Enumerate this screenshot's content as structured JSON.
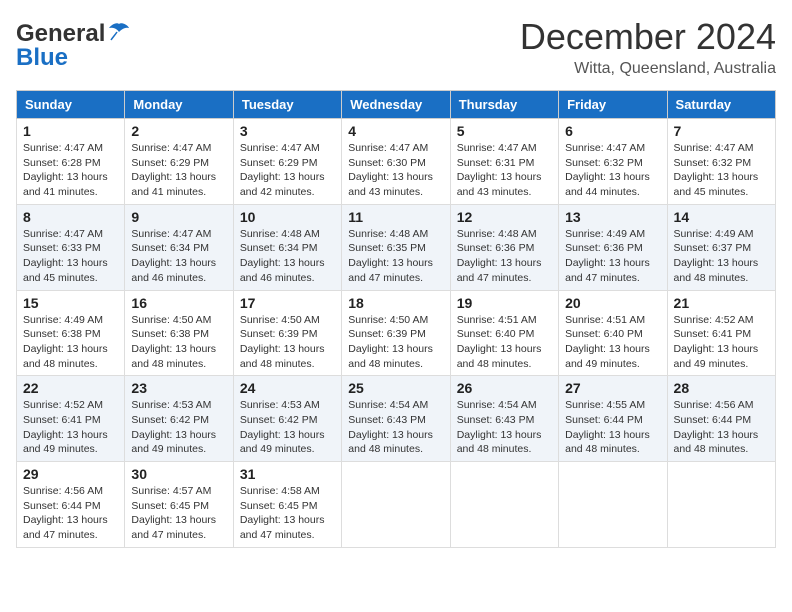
{
  "logo": {
    "general": "General",
    "blue": "Blue"
  },
  "header": {
    "month": "December 2024",
    "location": "Witta, Queensland, Australia"
  },
  "weekdays": [
    "Sunday",
    "Monday",
    "Tuesday",
    "Wednesday",
    "Thursday",
    "Friday",
    "Saturday"
  ],
  "weeks": [
    [
      {
        "day": "1",
        "sunrise": "4:47 AM",
        "sunset": "6:28 PM",
        "daylight": "13 hours and 41 minutes."
      },
      {
        "day": "2",
        "sunrise": "4:47 AM",
        "sunset": "6:29 PM",
        "daylight": "13 hours and 41 minutes."
      },
      {
        "day": "3",
        "sunrise": "4:47 AM",
        "sunset": "6:29 PM",
        "daylight": "13 hours and 42 minutes."
      },
      {
        "day": "4",
        "sunrise": "4:47 AM",
        "sunset": "6:30 PM",
        "daylight": "13 hours and 43 minutes."
      },
      {
        "day": "5",
        "sunrise": "4:47 AM",
        "sunset": "6:31 PM",
        "daylight": "13 hours and 43 minutes."
      },
      {
        "day": "6",
        "sunrise": "4:47 AM",
        "sunset": "6:32 PM",
        "daylight": "13 hours and 44 minutes."
      },
      {
        "day": "7",
        "sunrise": "4:47 AM",
        "sunset": "6:32 PM",
        "daylight": "13 hours and 45 minutes."
      }
    ],
    [
      {
        "day": "8",
        "sunrise": "4:47 AM",
        "sunset": "6:33 PM",
        "daylight": "13 hours and 45 minutes."
      },
      {
        "day": "9",
        "sunrise": "4:47 AM",
        "sunset": "6:34 PM",
        "daylight": "13 hours and 46 minutes."
      },
      {
        "day": "10",
        "sunrise": "4:48 AM",
        "sunset": "6:34 PM",
        "daylight": "13 hours and 46 minutes."
      },
      {
        "day": "11",
        "sunrise": "4:48 AM",
        "sunset": "6:35 PM",
        "daylight": "13 hours and 47 minutes."
      },
      {
        "day": "12",
        "sunrise": "4:48 AM",
        "sunset": "6:36 PM",
        "daylight": "13 hours and 47 minutes."
      },
      {
        "day": "13",
        "sunrise": "4:49 AM",
        "sunset": "6:36 PM",
        "daylight": "13 hours and 47 minutes."
      },
      {
        "day": "14",
        "sunrise": "4:49 AM",
        "sunset": "6:37 PM",
        "daylight": "13 hours and 48 minutes."
      }
    ],
    [
      {
        "day": "15",
        "sunrise": "4:49 AM",
        "sunset": "6:38 PM",
        "daylight": "13 hours and 48 minutes."
      },
      {
        "day": "16",
        "sunrise": "4:50 AM",
        "sunset": "6:38 PM",
        "daylight": "13 hours and 48 minutes."
      },
      {
        "day": "17",
        "sunrise": "4:50 AM",
        "sunset": "6:39 PM",
        "daylight": "13 hours and 48 minutes."
      },
      {
        "day": "18",
        "sunrise": "4:50 AM",
        "sunset": "6:39 PM",
        "daylight": "13 hours and 48 minutes."
      },
      {
        "day": "19",
        "sunrise": "4:51 AM",
        "sunset": "6:40 PM",
        "daylight": "13 hours and 48 minutes."
      },
      {
        "day": "20",
        "sunrise": "4:51 AM",
        "sunset": "6:40 PM",
        "daylight": "13 hours and 49 minutes."
      },
      {
        "day": "21",
        "sunrise": "4:52 AM",
        "sunset": "6:41 PM",
        "daylight": "13 hours and 49 minutes."
      }
    ],
    [
      {
        "day": "22",
        "sunrise": "4:52 AM",
        "sunset": "6:41 PM",
        "daylight": "13 hours and 49 minutes."
      },
      {
        "day": "23",
        "sunrise": "4:53 AM",
        "sunset": "6:42 PM",
        "daylight": "13 hours and 49 minutes."
      },
      {
        "day": "24",
        "sunrise": "4:53 AM",
        "sunset": "6:42 PM",
        "daylight": "13 hours and 49 minutes."
      },
      {
        "day": "25",
        "sunrise": "4:54 AM",
        "sunset": "6:43 PM",
        "daylight": "13 hours and 48 minutes."
      },
      {
        "day": "26",
        "sunrise": "4:54 AM",
        "sunset": "6:43 PM",
        "daylight": "13 hours and 48 minutes."
      },
      {
        "day": "27",
        "sunrise": "4:55 AM",
        "sunset": "6:44 PM",
        "daylight": "13 hours and 48 minutes."
      },
      {
        "day": "28",
        "sunrise": "4:56 AM",
        "sunset": "6:44 PM",
        "daylight": "13 hours and 48 minutes."
      }
    ],
    [
      {
        "day": "29",
        "sunrise": "4:56 AM",
        "sunset": "6:44 PM",
        "daylight": "13 hours and 47 minutes."
      },
      {
        "day": "30",
        "sunrise": "4:57 AM",
        "sunset": "6:45 PM",
        "daylight": "13 hours and 47 minutes."
      },
      {
        "day": "31",
        "sunrise": "4:58 AM",
        "sunset": "6:45 PM",
        "daylight": "13 hours and 47 minutes."
      },
      null,
      null,
      null,
      null
    ]
  ]
}
